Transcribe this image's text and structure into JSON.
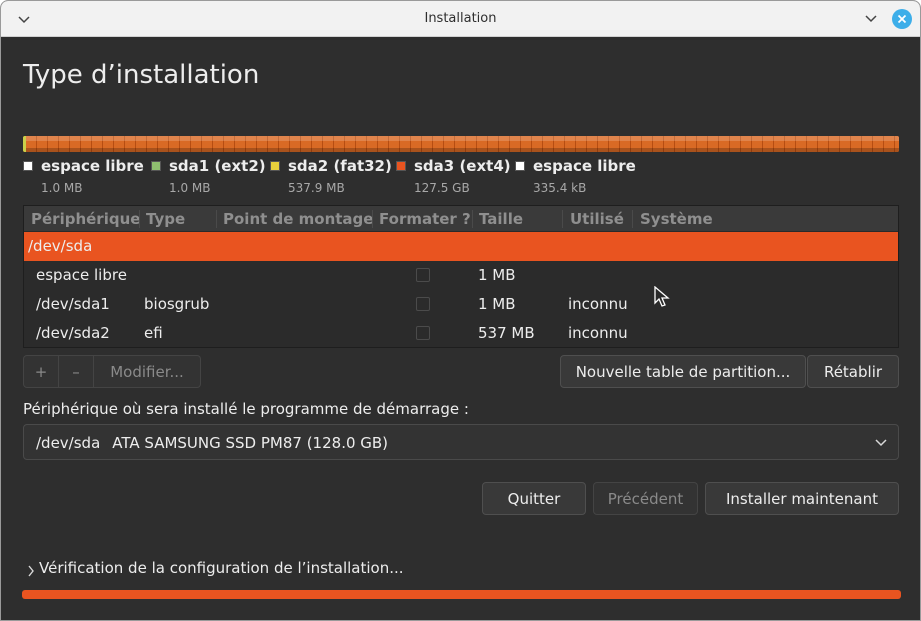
{
  "window": {
    "title": "Installation",
    "menu_icon": "chevron-down-icon",
    "minimize_icon": "chevron-down-icon",
    "close_icon": "close-icon"
  },
  "page": {
    "title": "Type d’installation"
  },
  "colors": {
    "accent": "#e95420",
    "background": "#2e2e2e",
    "sda3": "#e95420",
    "sda1": "#8fbf6f",
    "sda2": "#e8d03c",
    "free": "#ffffff"
  },
  "legend": [
    {
      "label": "espace libre",
      "size": "1.0 MB",
      "color": "#ffffff"
    },
    {
      "label": "sda1 (ext2)",
      "size": "1.0 MB",
      "color": "#8fbf6f"
    },
    {
      "label": "sda2 (fat32)",
      "size": "537.9 MB",
      "color": "#e8d03c"
    },
    {
      "label": "sda3 (ext4)",
      "size": "127.5 GB",
      "color": "#e95420"
    },
    {
      "label": "espace libre",
      "size": "335.4 kB",
      "color": "#ffffff"
    }
  ],
  "table": {
    "columns": [
      "Périphérique",
      "Type",
      "Point de montage",
      "Formater ?",
      "Taille",
      "Utilisé",
      "Système"
    ],
    "rows": [
      {
        "device": "/dev/sda",
        "type": "",
        "mount": "",
        "size": "",
        "used": "",
        "system": ""
      },
      {
        "device": "espace libre",
        "type": "",
        "mount": "",
        "size": "1 MB",
        "used": "",
        "system": ""
      },
      {
        "device": "/dev/sda1",
        "type": "biosgrub",
        "mount": "",
        "size": "1 MB",
        "used": "inconnu",
        "system": ""
      },
      {
        "device": "/dev/sda2",
        "type": "efi",
        "mount": "",
        "size": "537 MB",
        "used": "inconnu",
        "system": ""
      }
    ]
  },
  "toolbar": {
    "add_label": "+",
    "remove_label": "–",
    "modify_label": "Modifier..."
  },
  "buttons": {
    "new_table": "Nouvelle table de partition...",
    "revert": "Rétablir",
    "quit": "Quitter",
    "back": "Précédent",
    "install": "Installer maintenant"
  },
  "bootloader": {
    "label": "Périphérique où sera installé le programme de démarrage :",
    "device": "/dev/sda",
    "description": "ATA SAMSUNG SSD PM87 (128.0 GB)"
  },
  "status": {
    "expander_label": "Vérification de la configuration de l’installation...",
    "progress": 1.0
  }
}
